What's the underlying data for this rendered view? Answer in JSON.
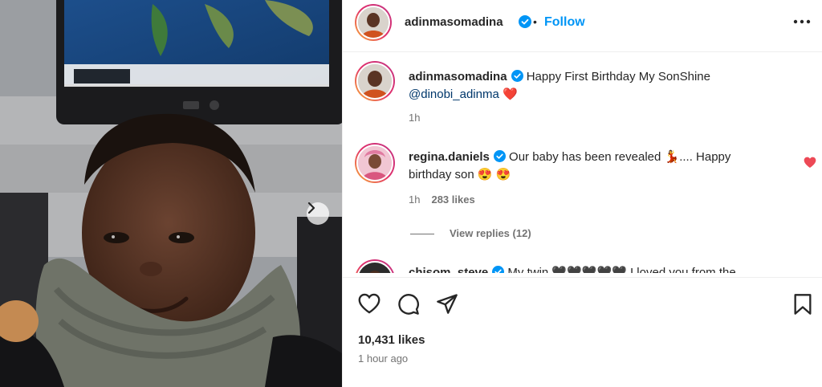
{
  "post": {
    "author": "adinmasomadina",
    "follow_label": "Follow",
    "separator": "•",
    "more_icon": "more-horizontal-icon"
  },
  "caption": {
    "username": "adinmasomadina",
    "text": "Happy First Birthday My SonShine",
    "mention": "@dinobi_adinma",
    "emoji": "❤️",
    "time": "1h"
  },
  "comments": [
    {
      "username": "regina.daniels",
      "text_1": "Our baby has been revealed",
      "emoji_1": "💃",
      "text_2": ".... Happy",
      "text_3": "birthday son",
      "emoji_2": "😍 😍",
      "time": "1h",
      "likes": "283 likes",
      "view_replies": "View replies (12)"
    },
    {
      "username": "chisom_steve",
      "text": "My twin 🖤🖤🖤🖤🖤 I loved you from the"
    }
  ],
  "footer": {
    "likes": "10,431 likes",
    "time": "1 hour ago"
  },
  "colors": {
    "accent": "#0095f6",
    "verified": "#0095f6",
    "heart": "#ed4956",
    "secondary_text": "#737373"
  }
}
